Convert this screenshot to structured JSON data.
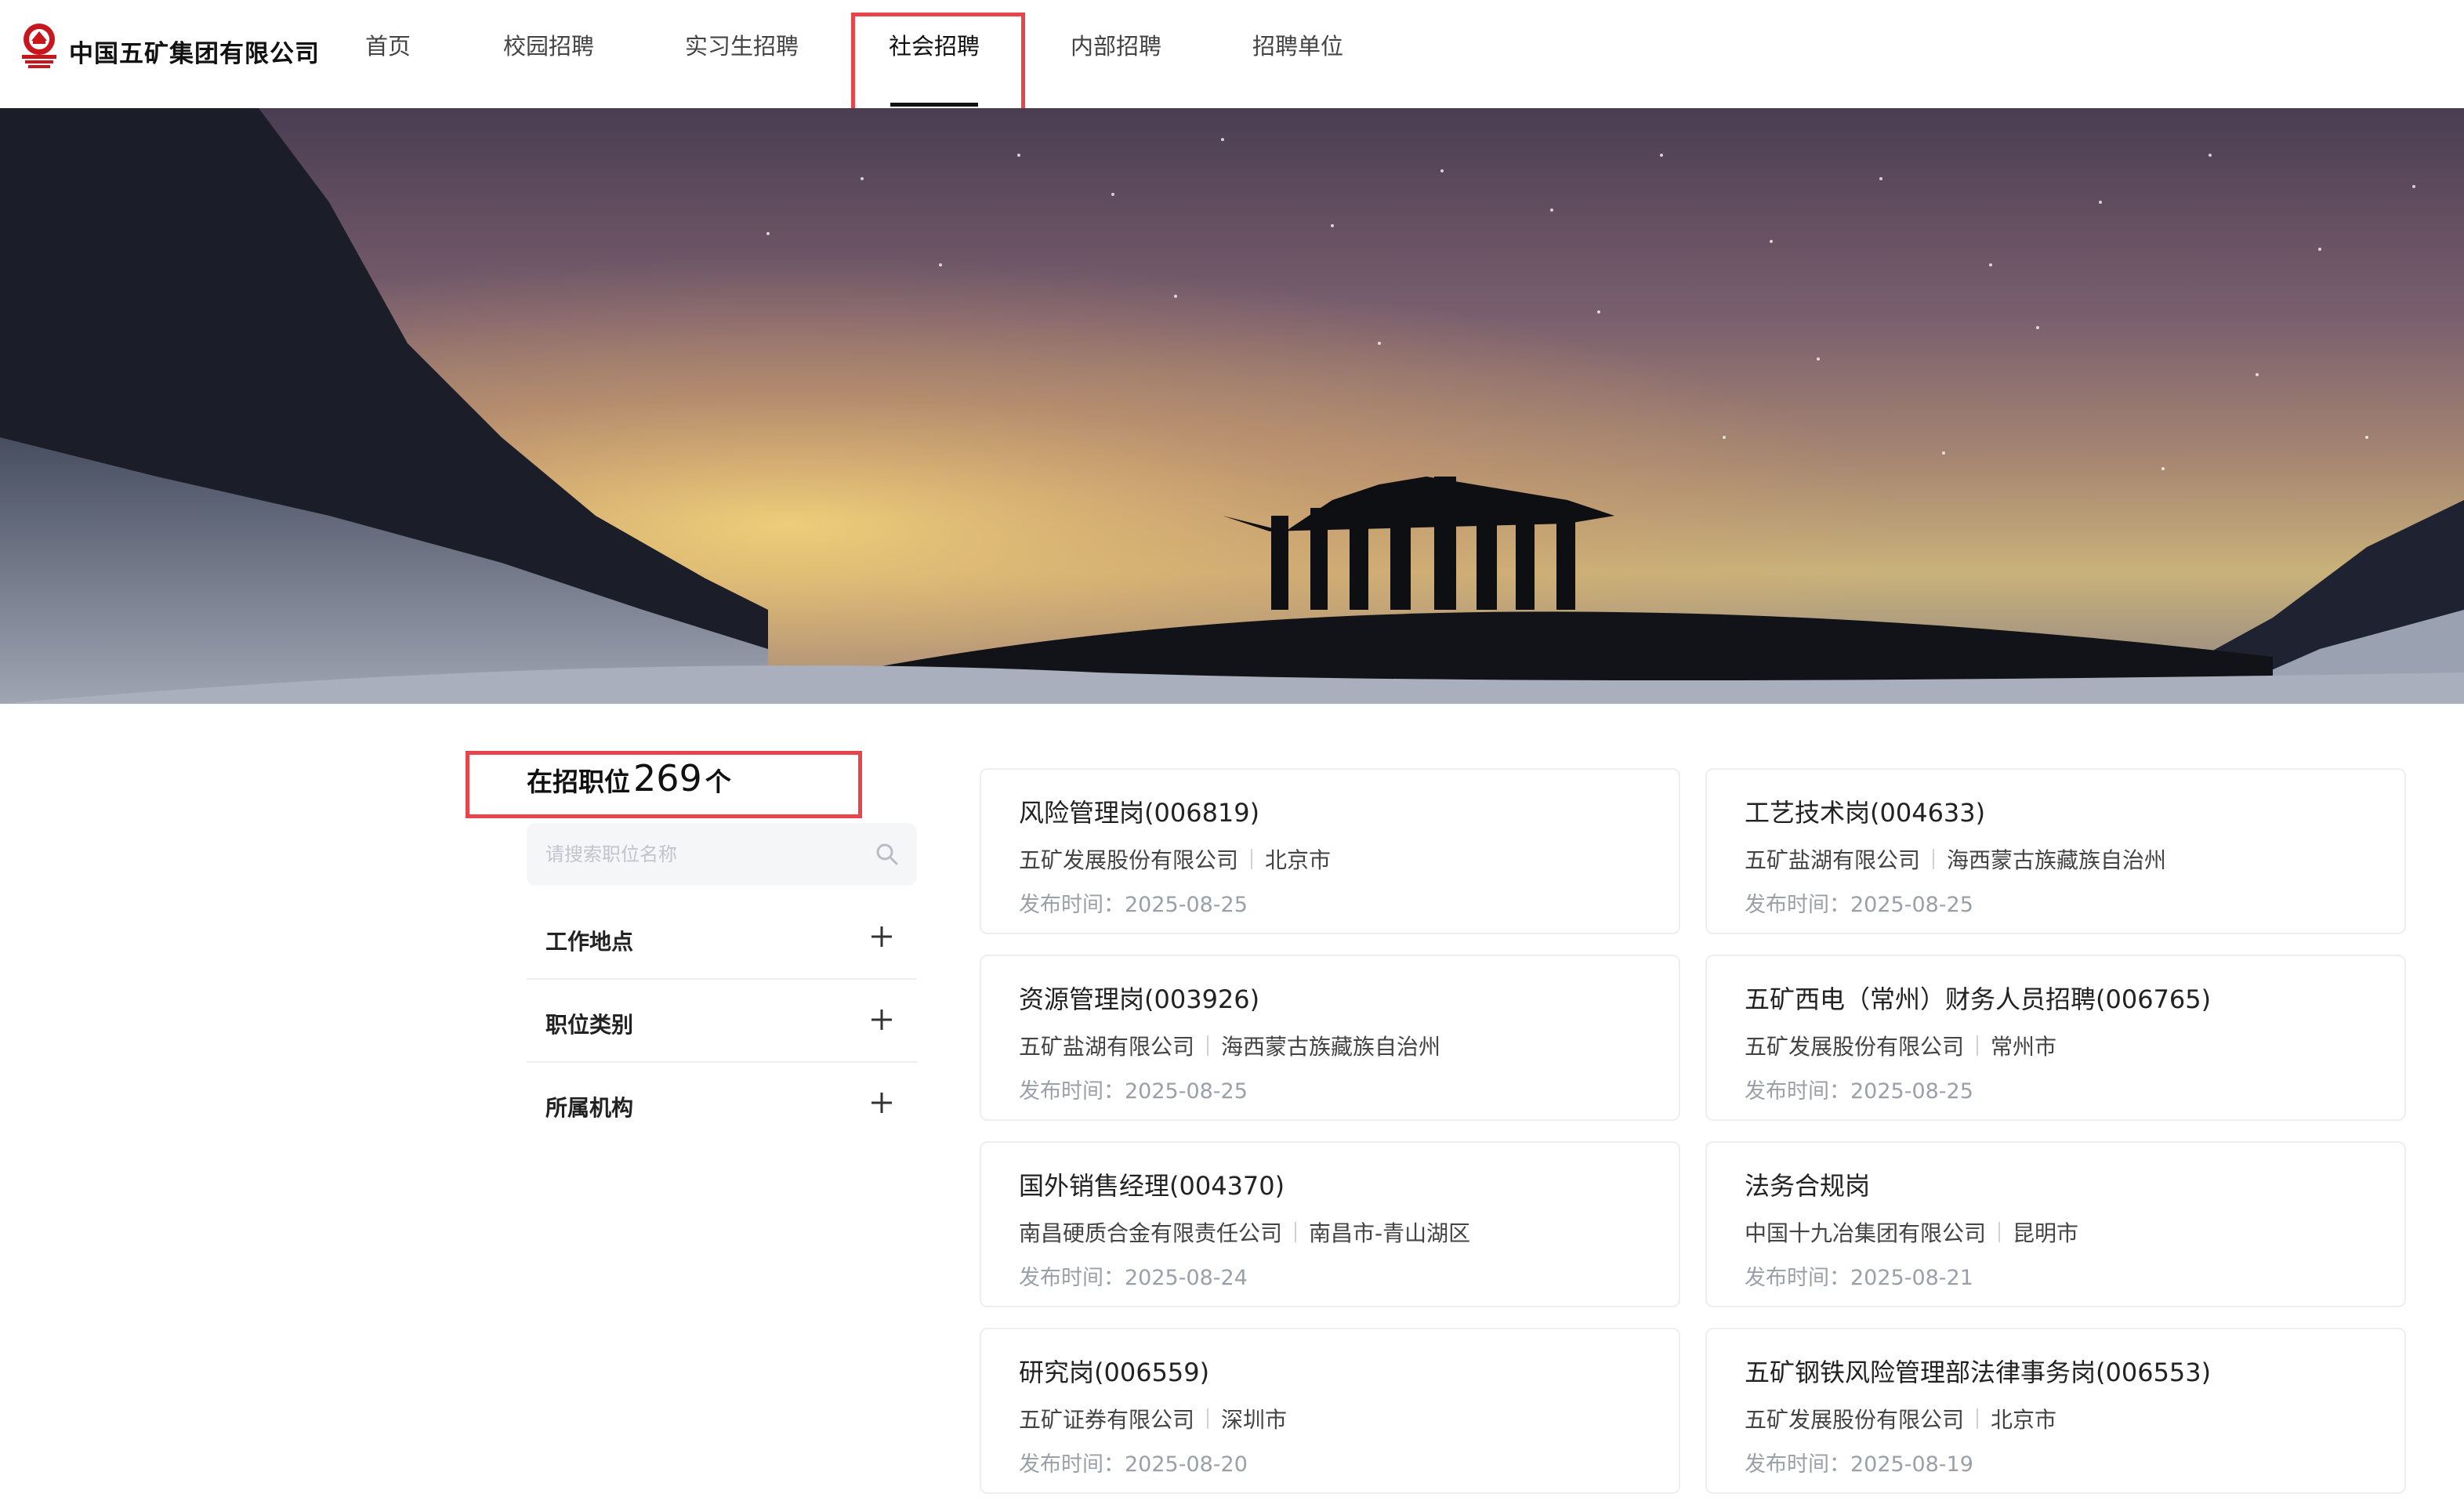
{
  "company": {
    "name": "中国五矿集团有限公司"
  },
  "nav": {
    "items": [
      {
        "label": "首页"
      },
      {
        "label": "校园招聘"
      },
      {
        "label": "实习生招聘"
      },
      {
        "label": "社会招聘"
      },
      {
        "label": "内部招聘"
      },
      {
        "label": "招聘单位"
      }
    ],
    "active": "社会招聘"
  },
  "sidebar": {
    "count_label": "在招职位",
    "count": "269",
    "count_unit": "个",
    "search_placeholder": "请搜索职位名称",
    "filters": [
      {
        "label": "工作地点"
      },
      {
        "label": "职位类别"
      },
      {
        "label": "所属机构"
      }
    ]
  },
  "jobs": [
    {
      "title": "风险管理岗(006819)",
      "company": "五矿发展股份有限公司",
      "location": "北京市",
      "date_label": "发布时间：",
      "date": "2025-08-25"
    },
    {
      "title": "工艺技术岗(004633)",
      "company": "五矿盐湖有限公司",
      "location": "海西蒙古族藏族自治州",
      "date_label": "发布时间：",
      "date": "2025-08-25"
    },
    {
      "title": "资源管理岗(003926)",
      "company": "五矿盐湖有限公司",
      "location": "海西蒙古族藏族自治州",
      "date_label": "发布时间：",
      "date": "2025-08-25"
    },
    {
      "title": "五矿西电（常州）财务人员招聘(006765)",
      "company": "五矿发展股份有限公司",
      "location": "常州市",
      "date_label": "发布时间：",
      "date": "2025-08-25"
    },
    {
      "title": "国外销售经理(004370)",
      "company": "南昌硬质合金有限责任公司",
      "location": "南昌市-青山湖区",
      "date_label": "发布时间：",
      "date": "2025-08-24"
    },
    {
      "title": "法务合规岗",
      "company": "中国十九冶集团有限公司",
      "location": "昆明市",
      "date_label": "发布时间：",
      "date": "2025-08-21"
    },
    {
      "title": "研究岗(006559)",
      "company": "五矿证券有限公司",
      "location": "深圳市",
      "date_label": "发布时间：",
      "date": "2025-08-20"
    },
    {
      "title": "五矿钢铁风险管理部法律事务岗(006553)",
      "company": "五矿发展股份有限公司",
      "location": "北京市",
      "date_label": "发布时间：",
      "date": "2025-08-19"
    }
  ],
  "colors": {
    "highlight": "#e8444c",
    "active_underline": "#111111"
  },
  "icons": {
    "logo": "company-logo-icon",
    "search": "search-icon",
    "expand": "plus-icon"
  }
}
